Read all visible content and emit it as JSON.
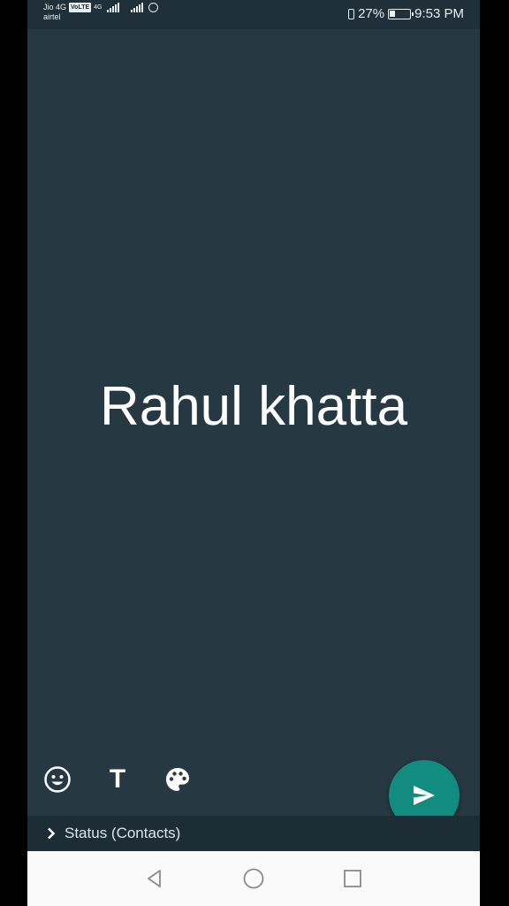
{
  "status_bar": {
    "carrier1": "Jio 4G",
    "volte": "VoLTE",
    "network": "4G",
    "carrier2": "airtel",
    "battery_percent": "27%",
    "battery_level": 0.27,
    "time": "9:53 PM",
    "icons": [
      "signal-icon",
      "signal-icon",
      "whatsapp-icon",
      "vibrate-icon",
      "battery-icon"
    ]
  },
  "status_composer": {
    "text": "Rahul khatta",
    "background_color": "#263842",
    "tools": [
      {
        "name": "emoji-icon"
      },
      {
        "name": "text-font-icon",
        "label": "T"
      },
      {
        "name": "palette-icon"
      }
    ],
    "send_icon": "send-icon",
    "fab_color": "#128c7e"
  },
  "audience": {
    "label": "Status (Contacts)",
    "icon": "chevron-right-icon"
  },
  "nav_bar": {
    "buttons": [
      "back-icon",
      "home-icon",
      "recents-icon"
    ]
  }
}
